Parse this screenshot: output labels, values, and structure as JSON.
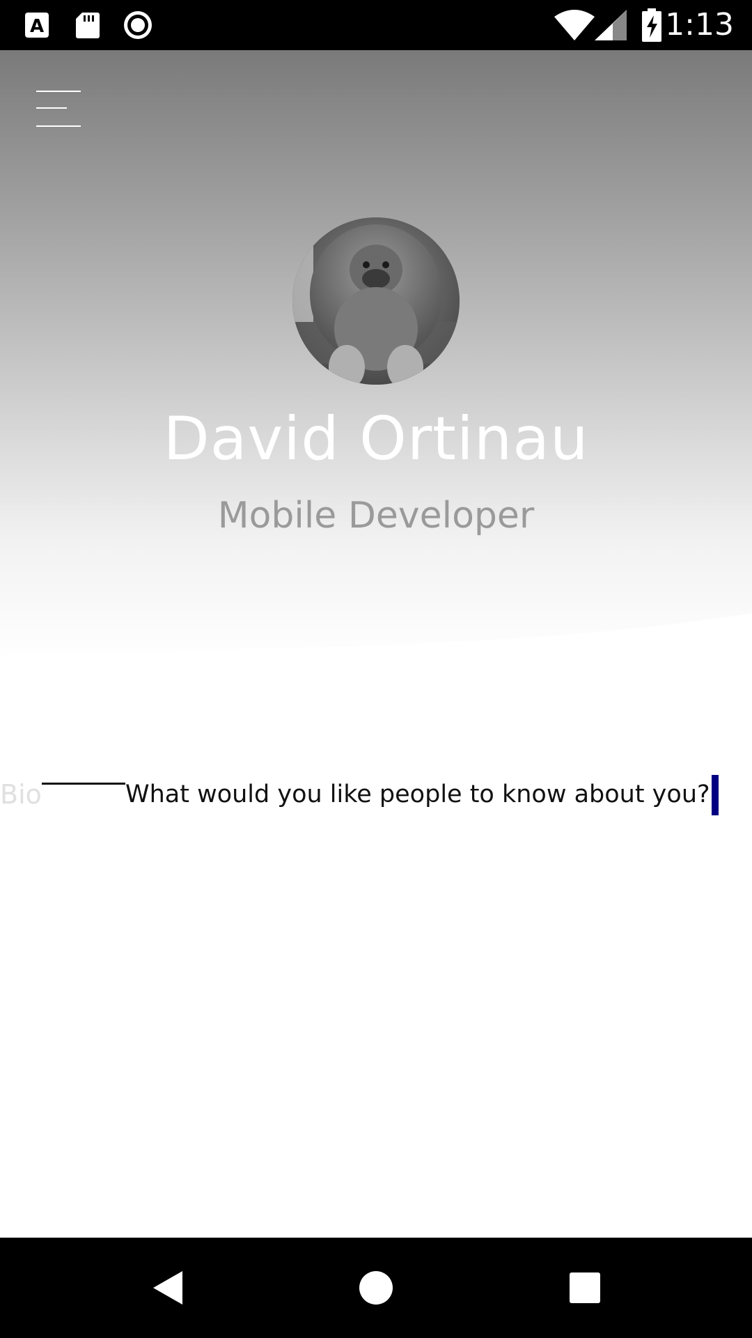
{
  "status_bar": {
    "time": "1:13",
    "left_icons": [
      "a-notification-icon",
      "sd-card-icon",
      "record-icon"
    ],
    "right_icons": [
      "wifi-icon",
      "signal-icon",
      "battery-charging-icon"
    ]
  },
  "header": {
    "menu_icon": "hamburger-menu-icon",
    "avatar": "profile-avatar",
    "name": "David Ortinau",
    "role": "Mobile Developer"
  },
  "bio": {
    "label": "Bio",
    "value": "What would you like people to know about you?"
  },
  "nav_bar": {
    "icons": [
      "back-icon",
      "home-icon",
      "recents-icon"
    ]
  },
  "colors": {
    "status_bar": "#000000",
    "caret": "#000080",
    "role_text": "#9a9a9a"
  }
}
